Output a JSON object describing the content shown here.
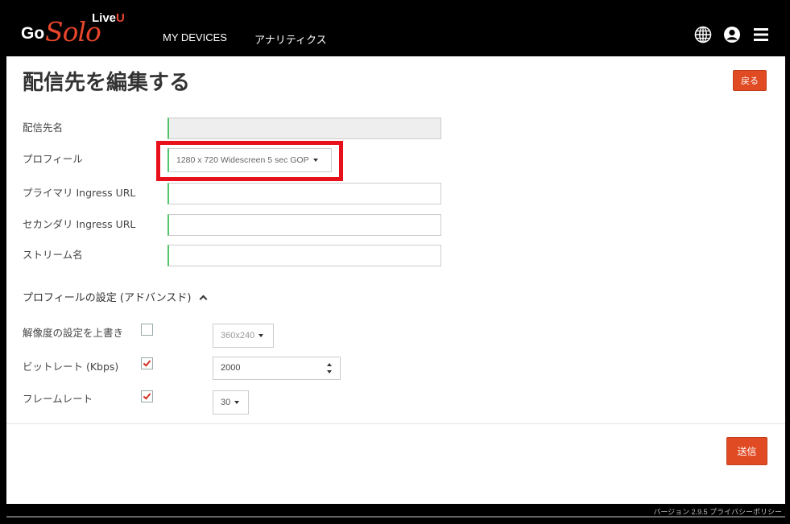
{
  "header": {
    "logo_go": "Go",
    "logo_solo": "Solo",
    "logo_live": "Live",
    "logo_u": "U",
    "nav_devices": "MY DEVICES",
    "nav_analytics": "アナリティクス",
    "icons": [
      "globe-icon",
      "user-icon",
      "menu-icon"
    ]
  },
  "page": {
    "title": "配信先を編集する",
    "back_label": "戻る"
  },
  "form": {
    "destination_name_label": "配信先名",
    "destination_name_value": "",
    "profile_label": "プロフィール",
    "profile_value": "1280 x 720 Widescreen 5 sec GOP",
    "primary_url_label": "プライマリ Ingress URL",
    "primary_url_value": "",
    "secondary_url_label": "セカンダリ Ingress URL",
    "secondary_url_value": "",
    "stream_name_label": "ストリーム名",
    "stream_name_value": ""
  },
  "advanced": {
    "section_label": "プロフィールの設定 (アドバンスド)",
    "resolution_label": "解像度の設定を上書き",
    "resolution_checked": false,
    "resolution_value": "360x240",
    "bitrate_label": "ビットレート (Kbps)",
    "bitrate_checked": true,
    "bitrate_value": "2000",
    "framerate_label": "フレームレート",
    "framerate_checked": true,
    "framerate_value": "30"
  },
  "actions": {
    "submit_label": "送信"
  },
  "footer": {
    "text": "バージョン 2.9.5  プライバシーポリシー"
  },
  "colors": {
    "accent": "#e04b24",
    "highlight": "#e8101a",
    "field_indicator": "#4fc56a"
  }
}
